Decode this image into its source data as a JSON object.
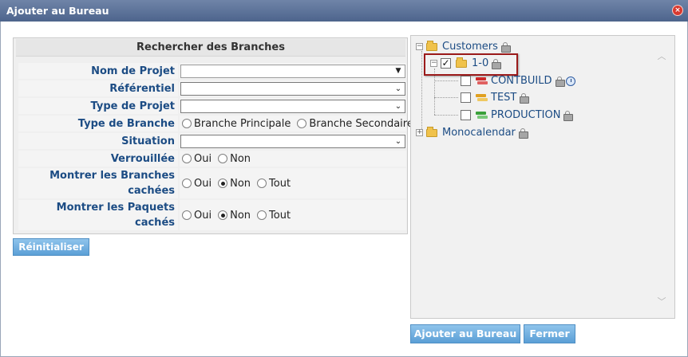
{
  "window": {
    "title": "Ajouter au Bureau",
    "close_glyph": "×"
  },
  "search": {
    "header": "Rechercher des Branches",
    "fields": {
      "nom_de_projet": {
        "label": "Nom de Projet",
        "value": ""
      },
      "referentiel": {
        "label": "Référentiel",
        "value": ""
      },
      "type_de_projet": {
        "label": "Type de Projet",
        "value": ""
      },
      "type_de_branche": {
        "label": "Type de Branche",
        "options": [
          "Branche Principale",
          "Branche Secondaire"
        ],
        "selected": null
      },
      "situation": {
        "label": "Situation",
        "value": ""
      },
      "verrouillee": {
        "label": "Verrouillée",
        "options": [
          "Oui",
          "Non"
        ],
        "selected": null
      },
      "branches_cachees": {
        "label_line1": "Montrer les Branches",
        "label_line2": "cachées",
        "options": [
          "Oui",
          "Non",
          "Tout"
        ],
        "selected": "Non"
      },
      "paquets_caches": {
        "label_line1": "Montrer les Paquets",
        "label_line2": "cachés",
        "options": [
          "Oui",
          "Non",
          "Tout"
        ],
        "selected": "Non"
      }
    },
    "reset_label": "Réinitialiser"
  },
  "tree": {
    "nodes": [
      {
        "label": "Customers",
        "expanded": true,
        "locked": true
      },
      {
        "label": "1-0",
        "checked": true,
        "locked": true,
        "highlighted": true
      },
      {
        "label": "CONTBUILD",
        "checked": false,
        "locked": true,
        "scheduled": true,
        "color": "#cc2a2a"
      },
      {
        "label": "TEST",
        "checked": false,
        "locked": true,
        "color": "#e0a020"
      },
      {
        "label": "PRODUCTION",
        "checked": false,
        "locked": true,
        "color": "#3aa03a"
      },
      {
        "label": "Monocalendar",
        "expanded": false,
        "locked": true
      }
    ],
    "expander_open": "−",
    "expander_closed": "+"
  },
  "actions": {
    "add_label": "Ajouter au Bureau",
    "close_label": "Fermer"
  },
  "colors": {
    "title_bar": "#5a7098",
    "label_text": "#1c4c84",
    "button": "#6aafe0",
    "highlight": "#9b1a1a"
  }
}
